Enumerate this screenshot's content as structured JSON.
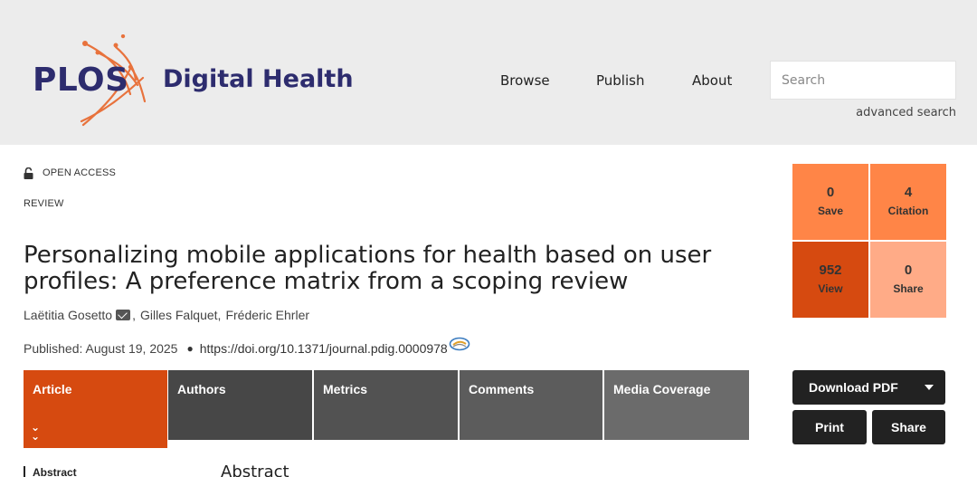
{
  "header": {
    "logo": {
      "publisher": "PLOS",
      "journal": "Digital Health"
    },
    "nav": [
      {
        "label": "Browse"
      },
      {
        "label": "Publish"
      },
      {
        "label": "About"
      }
    ],
    "search": {
      "placeholder": "Search",
      "value": ""
    },
    "advanced_search": "advanced search"
  },
  "article": {
    "access": "OPEN ACCESS",
    "type": "REVIEW",
    "title": "Personalizing mobile applications for health based on user profiles: A preference matrix from a scoping review",
    "authors": [
      {
        "name": "Laëtitia Gosetto",
        "separator": ","
      },
      {
        "name": "Gilles Falquet",
        "separator": ","
      },
      {
        "name": "Fréderic Ehrler",
        "separator": ""
      }
    ],
    "published": "Published: August 19, 2025",
    "doi": "https://doi.org/10.1371/journal.pdig.0000978"
  },
  "tabs": [
    {
      "label": "Article",
      "active": true
    },
    {
      "label": "Authors",
      "active": false
    },
    {
      "label": "Metrics",
      "active": false
    },
    {
      "label": "Comments",
      "active": false
    },
    {
      "label": "Media Coverage",
      "active": false
    }
  ],
  "metrics": [
    {
      "value": "0",
      "label": "Save",
      "color": "#ff8547"
    },
    {
      "value": "4",
      "label": "Citation",
      "color": "#ff8547"
    },
    {
      "value": "952",
      "label": "View",
      "color": "#d64a10"
    },
    {
      "value": "0",
      "label": "Share",
      "color": "#ffab87"
    }
  ],
  "actions": {
    "download": "Download PDF",
    "print": "Print",
    "share": "Share"
  },
  "section": {
    "side_label": "Abstract",
    "heading": "Abstract"
  },
  "colors": {
    "brand_navy": "#2d2c6e",
    "accent_orange": "#d64a10",
    "header_bg": "#ececec"
  },
  "icons": [
    "open-lock-icon",
    "mail-icon",
    "crossmark-icon",
    "double-chevron-down-icon",
    "caret-down-icon"
  ]
}
